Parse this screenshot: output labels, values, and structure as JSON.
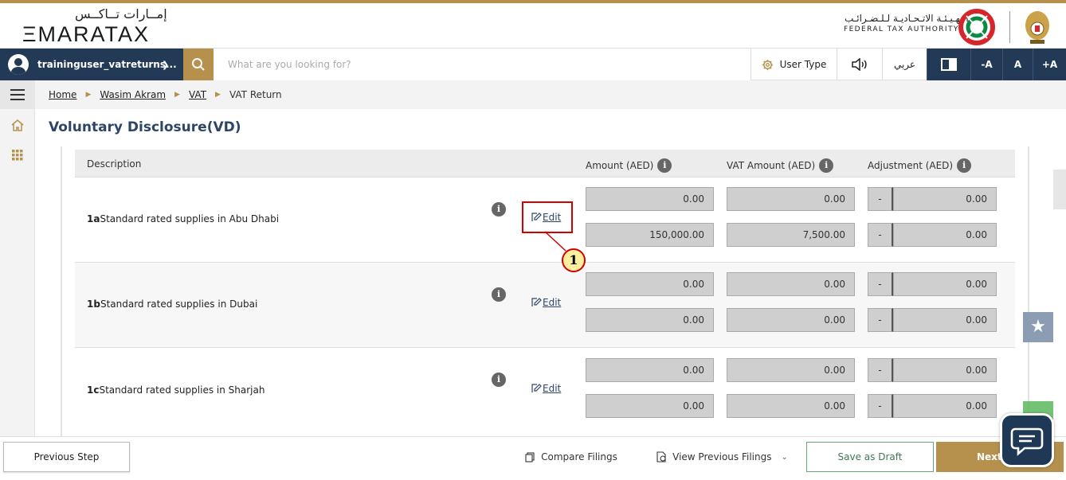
{
  "header": {
    "logo_ar": "إمــارات تــاكــس",
    "logo_en": "ΞMARATAX",
    "authority_ar": "الـهـيـئـة الاتـحـاديـة لـلـضـرائـب",
    "authority_en": "FEDERAL TAX AUTHORITY"
  },
  "nav": {
    "username": "traininguser_vatreturns...",
    "search_placeholder": "What are you looking for?",
    "user_type": "User Type",
    "arabic": "عربي",
    "font_decrease": "-A",
    "font_normal": "A",
    "font_increase": "+A"
  },
  "breadcrumb": {
    "items": [
      "Home",
      "Wasim Akram",
      "VAT"
    ],
    "current": "VAT Return"
  },
  "page_title": "Voluntary Disclosure(VD)",
  "table": {
    "headers": {
      "description": "Description",
      "amount": "Amount (AED)",
      "vat_amount": "VAT Amount (AED)",
      "adjustment": "Adjustment (AED)"
    },
    "edit_label": "Edit",
    "info_glyph": "i",
    "dash": "-",
    "rows": [
      {
        "code": "1a",
        "label": "Standard rated supplies in Abu Dhabi",
        "amount": [
          "0.00",
          "150,000.00"
        ],
        "vat": [
          "0.00",
          "7,500.00"
        ],
        "adjustment": [
          "0.00",
          "0.00"
        ]
      },
      {
        "code": "1b",
        "label": "Standard rated supplies in Dubai",
        "amount": [
          "0.00",
          "0.00"
        ],
        "vat": [
          "0.00",
          "0.00"
        ],
        "adjustment": [
          "0.00",
          "0.00"
        ]
      },
      {
        "code": "1c",
        "label": "Standard rated supplies in Sharjah",
        "amount": [
          "0.00",
          "0.00"
        ],
        "vat": [
          "0.00",
          "0.00"
        ],
        "adjustment": [
          "0.00",
          "0.00"
        ]
      }
    ]
  },
  "callout": {
    "number": "1"
  },
  "footer": {
    "previous_step": "Previous Step",
    "compare_filings": "Compare Filings",
    "view_previous_filings": "View Previous Filings",
    "save_draft": "Save as Draft",
    "next": "Next"
  },
  "colors": {
    "navy": "#233a57",
    "gold": "#b5914d",
    "title": "#2c4568",
    "callout_red": "#d40000"
  }
}
